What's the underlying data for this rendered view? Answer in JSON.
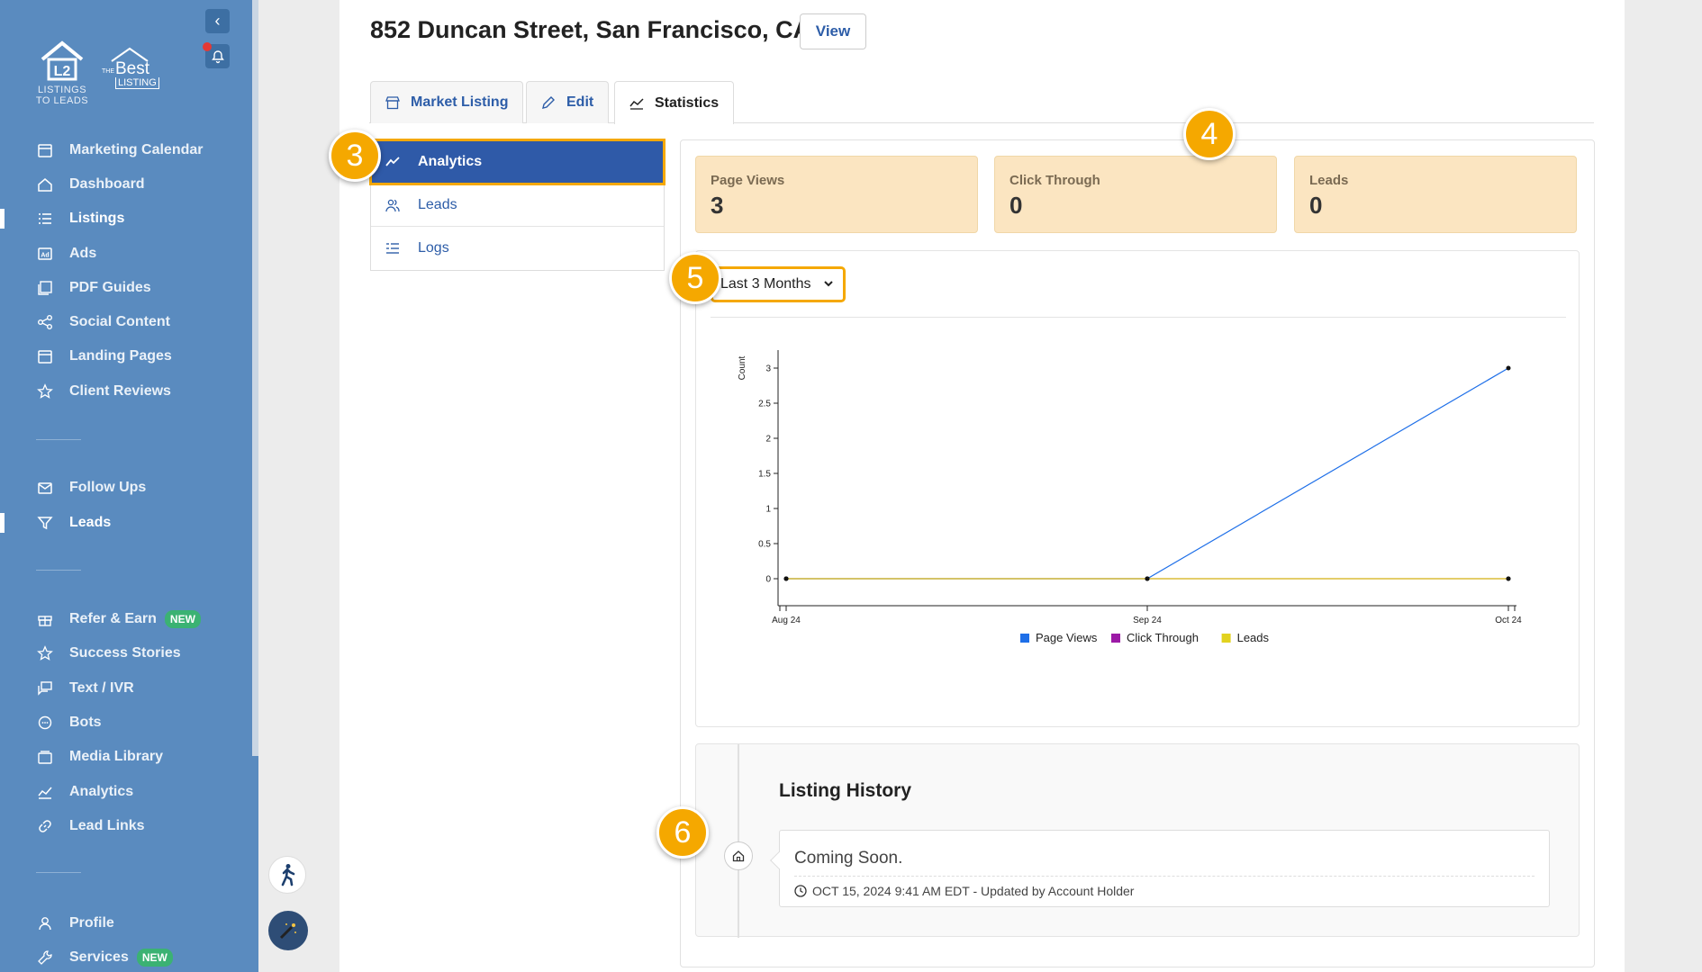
{
  "sidebar": {
    "logo_primary": "LISTINGS TO LEADS",
    "logo_secondary_the": "THE",
    "logo_secondary_best": "Best",
    "logo_secondary_listing": "LISTING",
    "groups": [
      [
        {
          "label": "Marketing Calendar",
          "icon": "calendar-icon"
        },
        {
          "label": "Dashboard",
          "icon": "home-icon"
        },
        {
          "label": "Listings",
          "icon": "list-icon",
          "active": true
        },
        {
          "label": "Ads",
          "icon": "ad-icon"
        },
        {
          "label": "PDF Guides",
          "icon": "pdf-icon"
        },
        {
          "label": "Social Content",
          "icon": "share-icon"
        },
        {
          "label": "Landing Pages",
          "icon": "window-icon"
        },
        {
          "label": "Client Reviews",
          "icon": "star-icon"
        }
      ],
      [
        {
          "label": "Follow Ups",
          "icon": "mail-icon"
        },
        {
          "label": "Leads",
          "icon": "filter-icon",
          "active": true
        }
      ],
      [
        {
          "label": "Refer & Earn",
          "icon": "gift-icon",
          "badge": "NEW"
        },
        {
          "label": "Success Stories",
          "icon": "star-icon"
        },
        {
          "label": "Text / IVR",
          "icon": "chat-icon"
        },
        {
          "label": "Bots",
          "icon": "bot-icon"
        },
        {
          "label": "Media Library",
          "icon": "folder-icon"
        },
        {
          "label": "Analytics",
          "icon": "chart-icon"
        },
        {
          "label": "Lead Links",
          "icon": "link-icon"
        }
      ],
      [
        {
          "label": "Profile",
          "icon": "user-icon"
        },
        {
          "label": "Services",
          "icon": "wrench-icon",
          "badge": "NEW"
        }
      ]
    ]
  },
  "header": {
    "title": "852 Duncan Street, San Francisco, CA",
    "view_label": "View"
  },
  "tabs": [
    {
      "label": "Market Listing",
      "icon": "store-icon"
    },
    {
      "label": "Edit",
      "icon": "pencil-icon"
    },
    {
      "label": "Statistics",
      "icon": "chart-line-icon",
      "active": true
    }
  ],
  "side_menu": [
    {
      "label": "Analytics",
      "icon": "trend-icon",
      "active": true
    },
    {
      "label": "Leads",
      "icon": "users-icon"
    },
    {
      "label": "Logs",
      "icon": "logs-icon"
    }
  ],
  "stats": [
    {
      "label": "Page Views",
      "value": "3"
    },
    {
      "label": "Click Through",
      "value": "0"
    },
    {
      "label": "Leads",
      "value": "0"
    }
  ],
  "range_select": {
    "selected": "Last 3 Months"
  },
  "chart_data": {
    "type": "line",
    "categories": [
      "Aug 24",
      "Sep 24",
      "Oct 24"
    ],
    "ylabel": "Count",
    "ylim": [
      0,
      3
    ],
    "yticks": [
      "0",
      "0.5",
      "1",
      "1.5",
      "2",
      "2.5",
      "3"
    ],
    "legend": "bottom",
    "series": [
      {
        "name": "Page Views",
        "values": [
          0,
          0,
          3
        ],
        "color": "#1e6fe8"
      },
      {
        "name": "Click Through",
        "values": [
          0,
          0,
          0
        ],
        "color": "#9c1aa6"
      },
      {
        "name": "Leads",
        "values": [
          0,
          0,
          0
        ],
        "color": "#e2d21f"
      }
    ]
  },
  "history": {
    "title": "Listing History",
    "entry_text": "Coming Soon.",
    "entry_meta": "OCT 15, 2024 9:41 AM EDT - Updated by Account Holder"
  },
  "markers": [
    "3",
    "4",
    "5",
    "6"
  ]
}
